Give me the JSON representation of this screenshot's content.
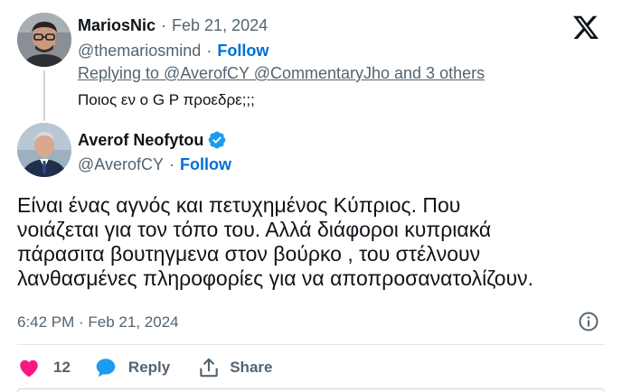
{
  "parent_tweet": {
    "display_name": "MariosNic",
    "date": "Feb 21, 2024",
    "handle": "@themariosmind",
    "follow_label": "Follow",
    "replying_to": "Replying to @AverofCY @CommentaryJho and 3 others",
    "text": "Ποιος εν ο G P προεδρε;;;",
    "avatar_icon": "person-avatar"
  },
  "main_tweet": {
    "display_name": "Averof Neofytou",
    "verified": true,
    "verified_icon": "verified-badge-icon",
    "handle": "@AverofCY",
    "follow_label": "Follow",
    "text_lines": [
      "Είναι ένας αγνός και πετυχημένος Κύπριος. Που",
      "νοιάζεται για τον τόπο του. Αλλά διάφοροι κυπριακά",
      "πάρασιτα βουτηγμενα στον βούρκο , του στέλνουν",
      "λανθασμένες πληροφορίες για να αποπροσανατολίζουν."
    ],
    "timestamp": "6:42 PM · Feb 21, 2024",
    "avatar_icon": "person-avatar"
  },
  "separator": "·",
  "actions": {
    "like_count": "12",
    "reply_label": "Reply",
    "share_label": "Share"
  },
  "icons": {
    "brand": "x-logo-icon",
    "info": "info-icon",
    "like": "heart-icon",
    "reply": "speech-bubble-icon",
    "share": "share-icon"
  },
  "colors": {
    "link_blue": "#006fd6",
    "muted_gray": "#536471",
    "heart_pink": "#f91880",
    "reply_blue": "#1d9bf0",
    "verified_blue": "#1d9bf0"
  }
}
